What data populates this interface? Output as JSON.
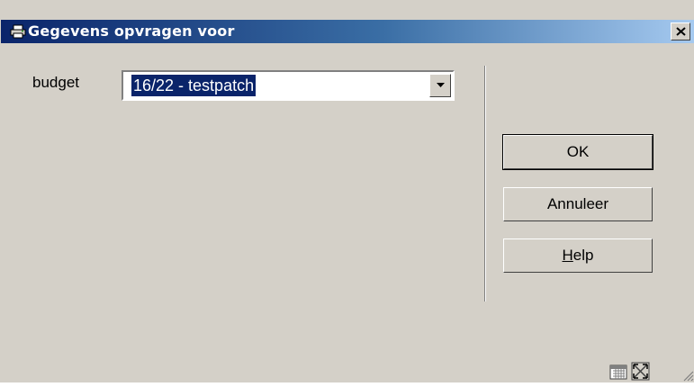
{
  "window": {
    "title": "Gegevens opvragen voor",
    "title_icon": "printer-icon",
    "close_icon": "close-icon"
  },
  "form": {
    "budget_label": "budget",
    "budget_value": "16/22 - testpatch"
  },
  "buttons": {
    "ok": "OK",
    "cancel": "Annuleer",
    "help_first": "H",
    "help_rest": "elp"
  },
  "colors": {
    "face": "#d4d0c8",
    "title_start": "#0a246a",
    "title_end": "#a6caf0",
    "selection": "#0a246a"
  }
}
